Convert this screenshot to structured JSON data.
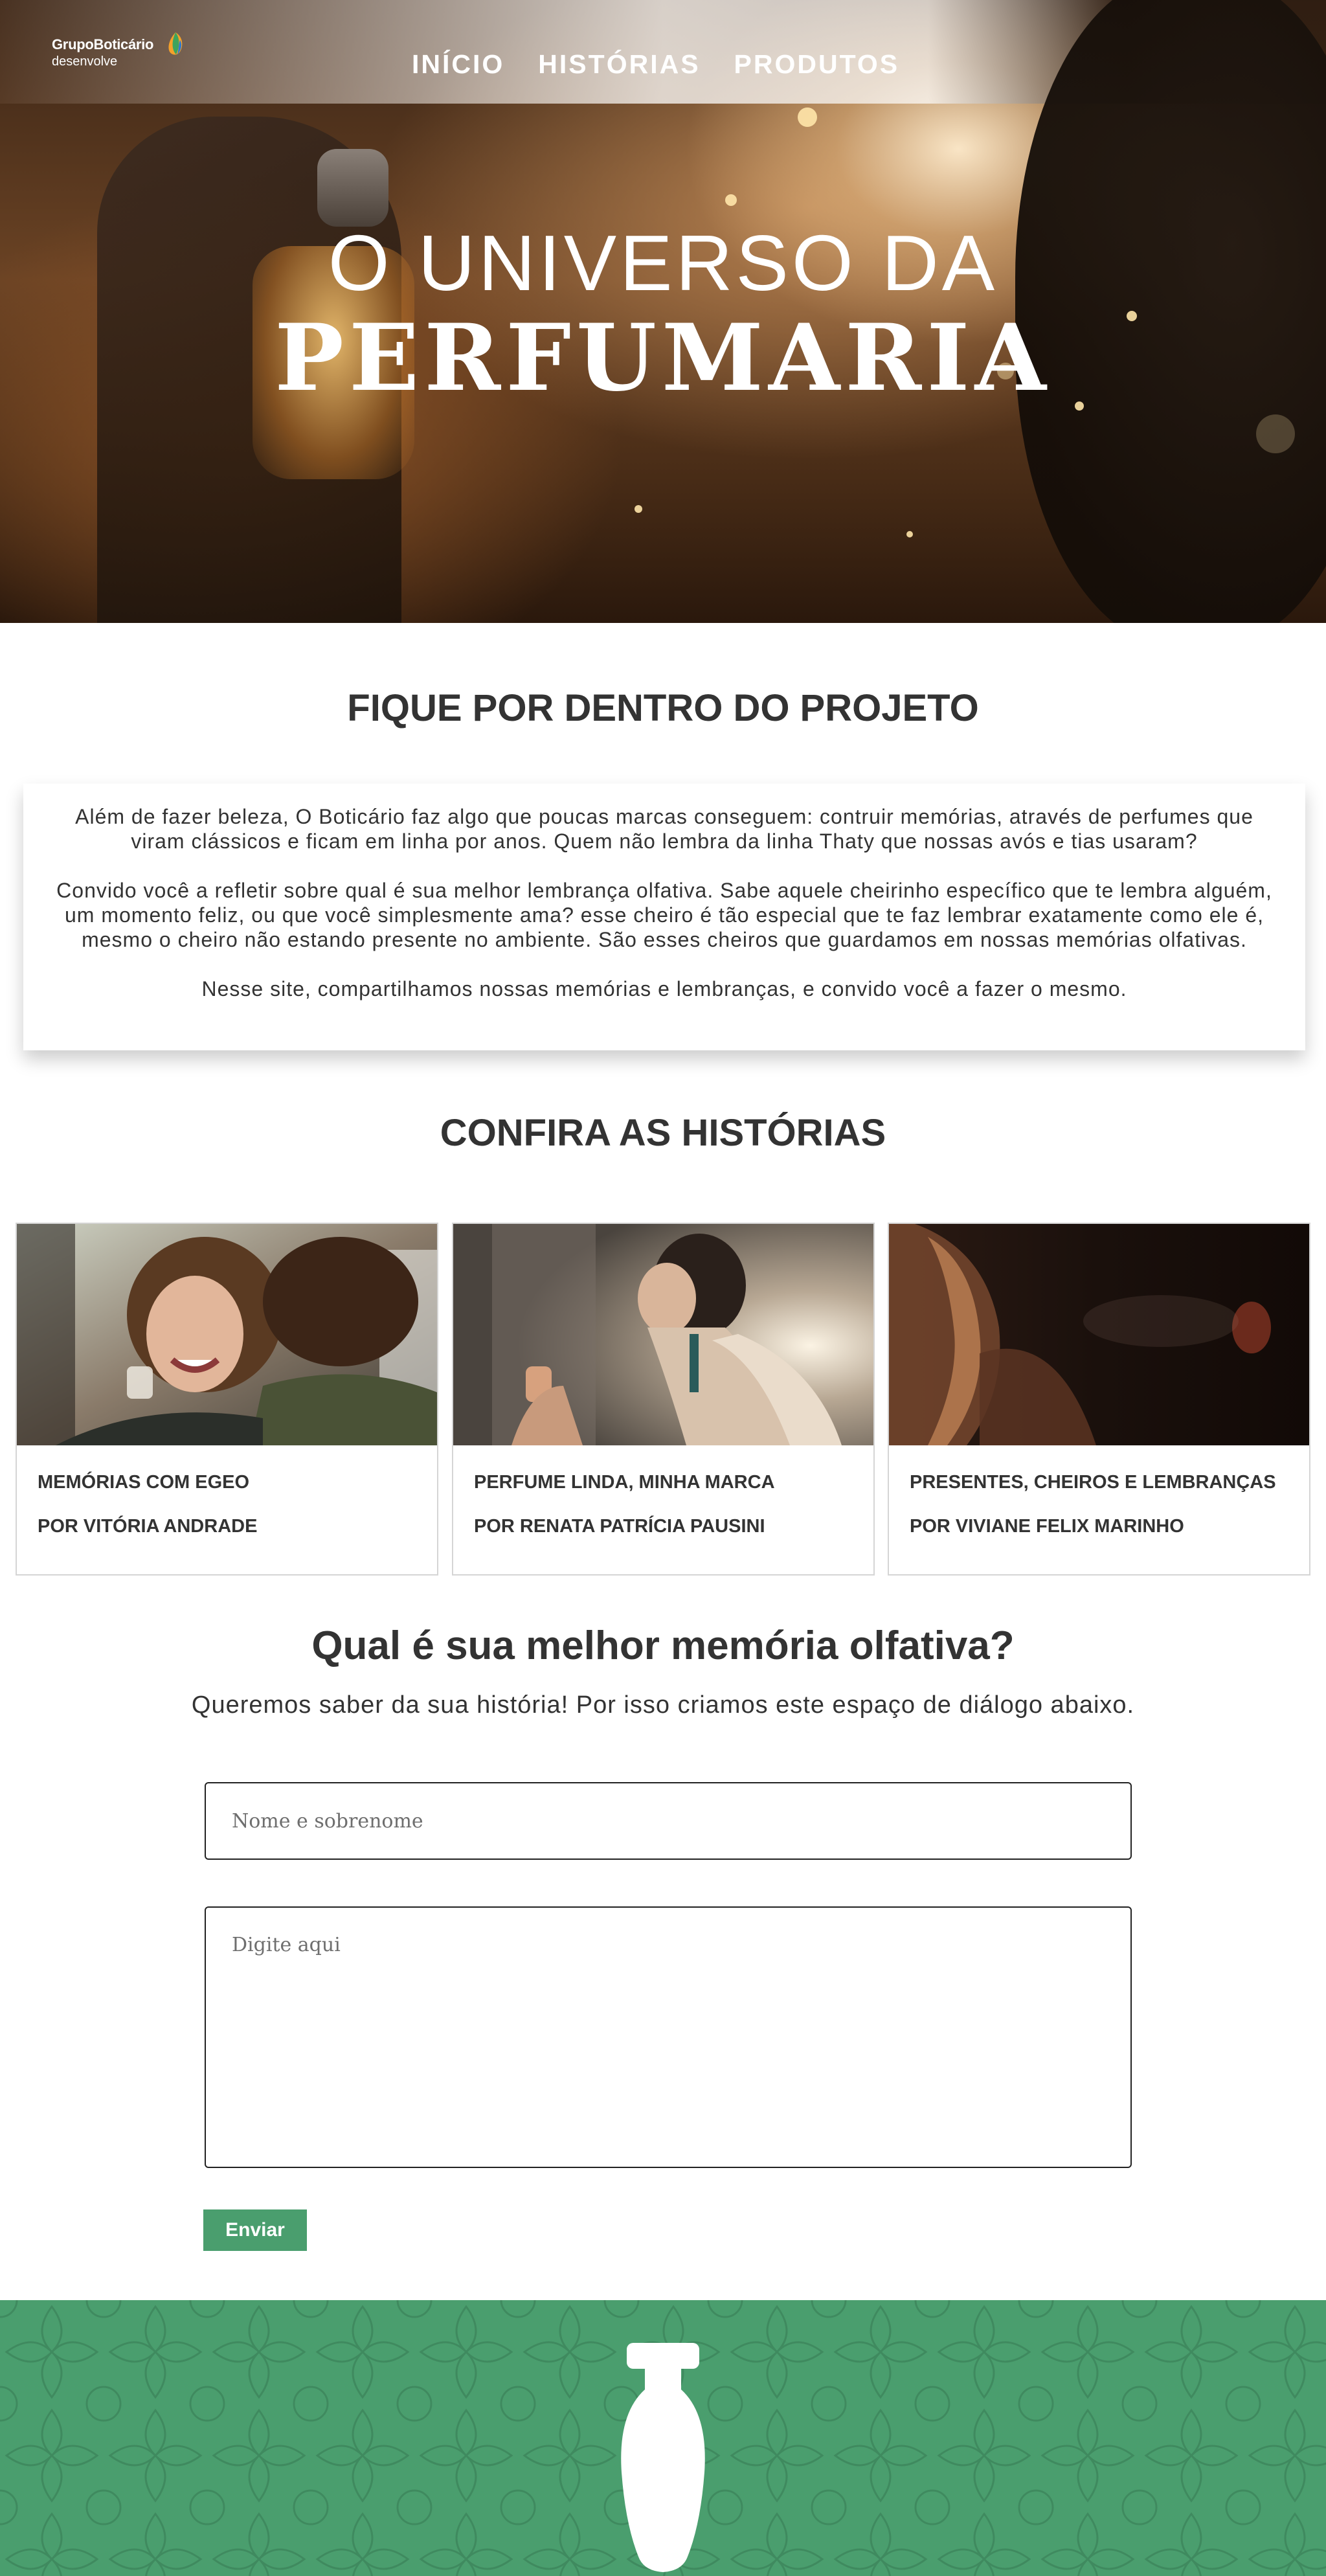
{
  "header": {
    "logo_line1": "GrupoBoticário",
    "logo_line2": "desenvolve",
    "nav": [
      "INÍCIO",
      "HISTÓRIAS",
      "PRODUTOS"
    ]
  },
  "hero": {
    "title_line1": "O UNIVERSO DA",
    "title_line2": "PERFUMARIA"
  },
  "about": {
    "title": "FIQUE POR DENTRO DO PROJETO",
    "paragraphs": [
      "Além de fazer beleza, O Boticário faz algo que poucas marcas conseguem: contruir memórias, através de perfumes que viram clássicos e ficam em linha por anos. Quem não lembra da linha Thaty que nossas avós e tias usaram?",
      "Convido você a refletir sobre qual é sua melhor lembrança olfativa. Sabe aquele cheirinho específico que te lembra alguém, um momento feliz, ou que você simplesmente ama? esse cheiro é tão especial que te faz lembrar exatamente como ele é, mesmo o cheiro não estando presente no ambiente. São esses cheiros que guardamos em nossas memórias olfativas.",
      "Nesse site, compartilhamos nossas memórias e lembranças, e convido você a fazer o mesmo."
    ]
  },
  "stories": {
    "title": "CONFIRA AS HISTÓRIAS",
    "cards": [
      {
        "title": "MEMÓRIAS COM EGEO",
        "author": "POR VITÓRIA ANDRADE"
      },
      {
        "title": "PERFUME LINDA, MINHA MARCA",
        "author": "POR RENATA PATRÍCIA PAUSINI"
      },
      {
        "title": "PRESENTES, CHEIROS E LEMBRANÇAS",
        "author": "POR VIVIANE FELIX MARINHO"
      }
    ]
  },
  "form": {
    "title": "Qual é sua melhor memória olfativa?",
    "subtitle": "Queremos saber da sua história! Por isso criamos este espaço de diálogo abaixo.",
    "name_placeholder": "Nome e sobrenome",
    "message_placeholder": "Digite aqui",
    "submit_label": "Enviar"
  },
  "colors": {
    "brand_green": "#4a9e6e",
    "text_dark": "#333333"
  }
}
